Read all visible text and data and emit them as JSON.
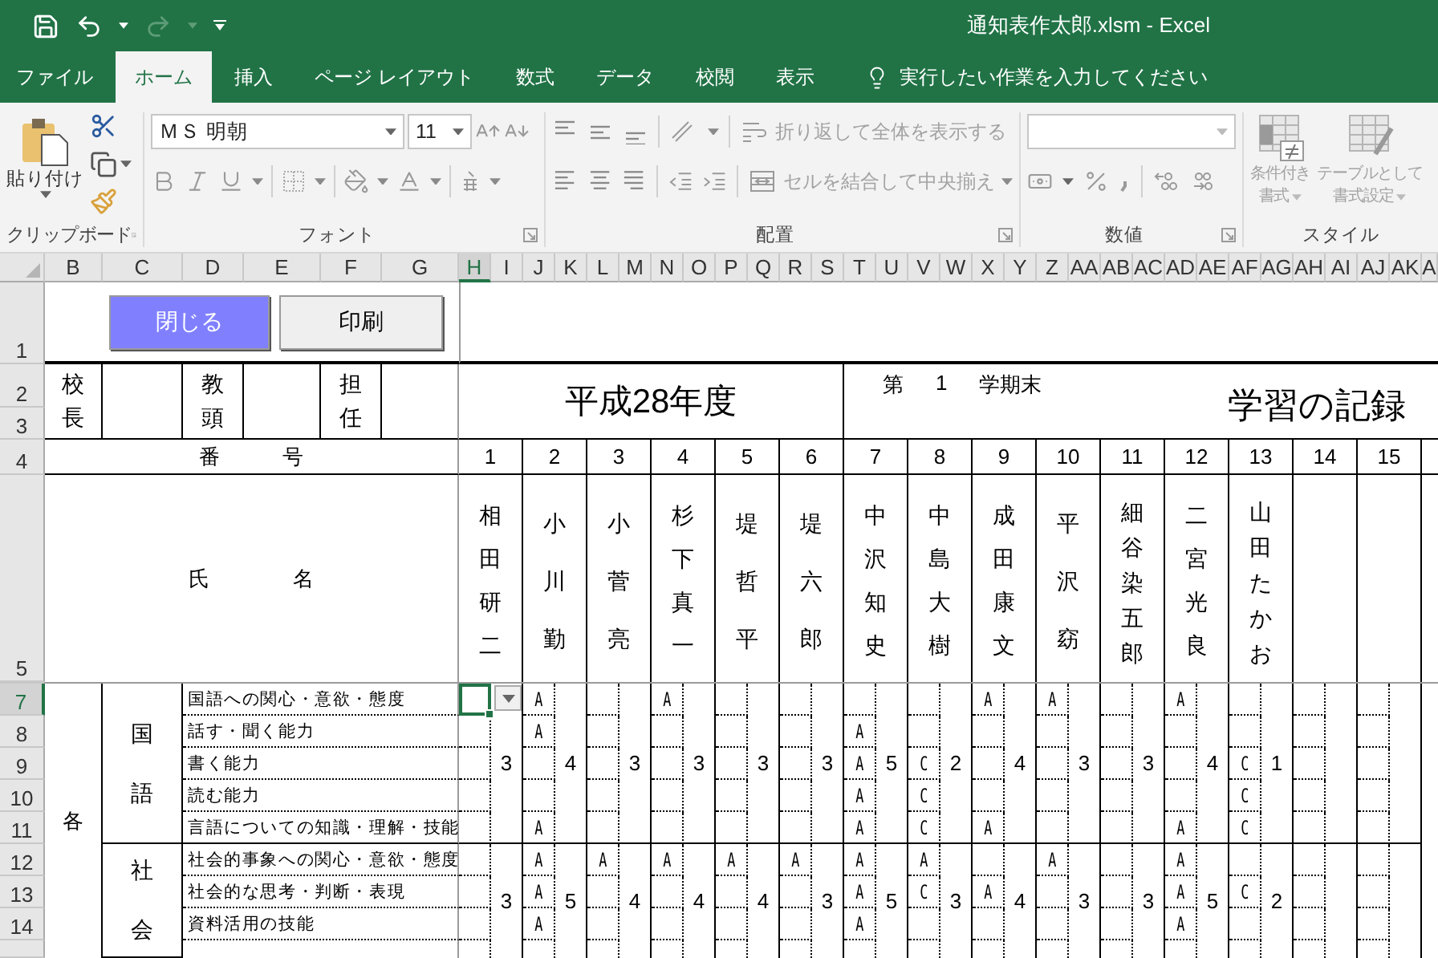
{
  "window": {
    "title": "通知表作太郎.xlsm - Excel"
  },
  "tabs": [
    {
      "label": "ファイル",
      "selected": false
    },
    {
      "label": "ホーム",
      "selected": true
    },
    {
      "label": "挿入",
      "selected": false
    },
    {
      "label": "ページ レイアウト",
      "selected": false
    },
    {
      "label": "数式",
      "selected": false
    },
    {
      "label": "データ",
      "selected": false
    },
    {
      "label": "校閲",
      "selected": false
    },
    {
      "label": "表示",
      "selected": false
    }
  ],
  "tell_me": {
    "placeholder": "実行したい作業を入力してください"
  },
  "ribbon": {
    "clipboard": {
      "label": "クリップボード",
      "paste": "貼り付け"
    },
    "font": {
      "label": "フォント",
      "font_name": "ＭＳ 明朝",
      "font_size": "11"
    },
    "alignment": {
      "label": "配置",
      "wrap_text": {
        "label": "折り返して全体を表示する",
        "disabled": true
      },
      "merge": {
        "label": "セルを結合して中央揃え",
        "disabled": true
      }
    },
    "number": {
      "label": "数値"
    },
    "styles": {
      "label": "スタイル",
      "buttons": [
        {
          "lines": [
            "条件付き",
            "書式"
          ],
          "disabled": true
        },
        {
          "lines": [
            "テーブルとして",
            "書式設定"
          ],
          "disabled": true
        }
      ]
    }
  },
  "sheet": {
    "column_headers": [
      {
        "label": "B",
        "selected": false
      },
      {
        "label": "C",
        "selected": false
      },
      {
        "label": "D",
        "selected": false
      },
      {
        "label": "E",
        "selected": false
      },
      {
        "label": "F",
        "selected": false
      },
      {
        "label": "G",
        "selected": false
      },
      {
        "label": "H",
        "selected": true
      },
      {
        "label": "I",
        "selected": false
      },
      {
        "label": "J",
        "selected": false
      },
      {
        "label": "K",
        "selected": false
      },
      {
        "label": "L",
        "selected": false
      },
      {
        "label": "M",
        "selected": false
      },
      {
        "label": "N",
        "selected": false
      },
      {
        "label": "O",
        "selected": false
      },
      {
        "label": "P",
        "selected": false
      },
      {
        "label": "Q",
        "selected": false
      },
      {
        "label": "R",
        "selected": false
      },
      {
        "label": "S",
        "selected": false
      },
      {
        "label": "T",
        "selected": false
      },
      {
        "label": "U",
        "selected": false
      },
      {
        "label": "V",
        "selected": false
      },
      {
        "label": "W",
        "selected": false
      },
      {
        "label": "X",
        "selected": false
      },
      {
        "label": "Y",
        "selected": false
      },
      {
        "label": "Z",
        "selected": false
      },
      {
        "label": "AA",
        "selected": false
      },
      {
        "label": "AB",
        "selected": false
      },
      {
        "label": "AC",
        "selected": false
      },
      {
        "label": "AD",
        "selected": false
      },
      {
        "label": "AE",
        "selected": false
      },
      {
        "label": "AF",
        "selected": false
      },
      {
        "label": "AG",
        "selected": false
      },
      {
        "label": "AH",
        "selected": false
      },
      {
        "label": "AI",
        "selected": false
      },
      {
        "label": "AJ",
        "selected": false
      },
      {
        "label": "AK",
        "selected": false
      },
      {
        "label": "A",
        "selected": false
      }
    ],
    "row_headers": [
      {
        "label": "1",
        "selected": false
      },
      {
        "label": "2",
        "selected": false
      },
      {
        "label": "3",
        "selected": false
      },
      {
        "label": "4",
        "selected": false
      },
      {
        "label": "5",
        "selected": false
      },
      {
        "label": "7",
        "selected": true
      },
      {
        "label": "8",
        "selected": false
      },
      {
        "label": "9",
        "selected": false
      },
      {
        "label": "10",
        "selected": false
      },
      {
        "label": "11",
        "selected": false
      },
      {
        "label": "12",
        "selected": false
      },
      {
        "label": "13",
        "selected": false
      },
      {
        "label": "14",
        "selected": false
      }
    ],
    "active_cell": {
      "dropdown": true
    },
    "buttons": [
      {
        "label": "閉じる",
        "kind": "primary"
      },
      {
        "label": "印刷",
        "kind": "plain"
      }
    ],
    "signatures": [
      {
        "label": "校長"
      },
      {
        "label": "教頭"
      },
      {
        "label": "担任"
      }
    ],
    "year": "平成28年度",
    "term": [
      "第",
      "1",
      "学期末"
    ],
    "record_title": "学習の記録",
    "number_label": "番　　　号",
    "name_label": "氏　　　　名",
    "section_label": "各",
    "subjects": [
      {
        "name": "国語",
        "items": [
          "国語への関心・意欲・態度",
          "話す・聞く能力",
          "書く能力",
          "読む能力",
          "言語についての知識・理解・技能"
        ]
      },
      {
        "name": "社会",
        "items": [
          "社会的事象への関心・意欲・態度",
          "社会的な思考・判断・表現",
          "資料活用の技能"
        ]
      }
    ],
    "students": [
      {
        "number": "1",
        "name": "相田研二",
        "grades": [
          {
            "score": "3"
          },
          {
            "score": "3"
          }
        ]
      },
      {
        "number": "2",
        "name": "小川勤",
        "grades": [
          {
            "score": "4",
            "marks": {
              "item_1": "A",
              "item_2": "A",
              "item_5": "A"
            }
          },
          {
            "score": "5",
            "marks": {
              "item_1": "A",
              "item_2": "A",
              "item_3": "A"
            }
          }
        ]
      },
      {
        "number": "3",
        "name": "小菅亮",
        "grades": [
          {
            "score": "3"
          },
          {
            "score": "4",
            "marks": {
              "item_1": "A"
            }
          }
        ]
      },
      {
        "number": "4",
        "name": "杉下真一",
        "grades": [
          {
            "score": "3",
            "marks": {
              "item_1": "A"
            }
          },
          {
            "score": "4",
            "marks": {
              "item_1": "A"
            }
          }
        ]
      },
      {
        "number": "5",
        "name": "堤哲平",
        "grades": [
          {
            "score": "3"
          },
          {
            "score": "4",
            "marks": {
              "item_1": "A"
            }
          }
        ]
      },
      {
        "number": "6",
        "name": "堤六郎",
        "grades": [
          {
            "score": "3"
          },
          {
            "score": "3",
            "marks": {
              "item_1": "A"
            }
          }
        ]
      },
      {
        "number": "7",
        "name": "中沢知史",
        "grades": [
          {
            "score": "5",
            "marks": {
              "item_2": "A",
              "item_3": "A",
              "item_4": "A",
              "item_5": "A"
            }
          },
          {
            "score": "5",
            "marks": {
              "item_1": "A",
              "item_2": "A",
              "item_3": "A"
            }
          }
        ]
      },
      {
        "number": "8",
        "name": "中島大樹",
        "grades": [
          {
            "score": "2",
            "marks": {
              "item_3": "C",
              "item_4": "C",
              "item_5": "C"
            }
          },
          {
            "score": "3",
            "marks": {
              "item_1": "A",
              "item_2": "C"
            }
          }
        ]
      },
      {
        "number": "9",
        "name": "成田康文",
        "grades": [
          {
            "score": "4",
            "marks": {
              "item_1": "A",
              "item_5": "A"
            }
          },
          {
            "score": "4",
            "marks": {
              "item_2": "A"
            }
          }
        ]
      },
      {
        "number": "10",
        "name": "平沢窈",
        "grades": [
          {
            "score": "3",
            "marks": {
              "item_1": "A"
            }
          },
          {
            "score": "3",
            "marks": {
              "item_1": "A"
            }
          }
        ]
      },
      {
        "number": "11",
        "name": "細谷染五郎",
        "grades": [
          {
            "score": "3"
          },
          {
            "score": "3"
          }
        ]
      },
      {
        "number": "12",
        "name": "二宮光良",
        "grades": [
          {
            "score": "4",
            "marks": {
              "item_1": "A",
              "item_5": "A"
            }
          },
          {
            "score": "5",
            "marks": {
              "item_1": "A",
              "item_2": "A",
              "item_3": "A"
            }
          }
        ]
      },
      {
        "number": "13",
        "name": "山田たかお",
        "grades": [
          {
            "score": "1",
            "marks": {
              "item_3": "C",
              "item_4": "C",
              "item_5": "C"
            }
          },
          {
            "score": "2",
            "marks": {
              "item_2": "C"
            }
          }
        ]
      },
      {
        "number": "14"
      },
      {
        "number": "15"
      }
    ]
  }
}
